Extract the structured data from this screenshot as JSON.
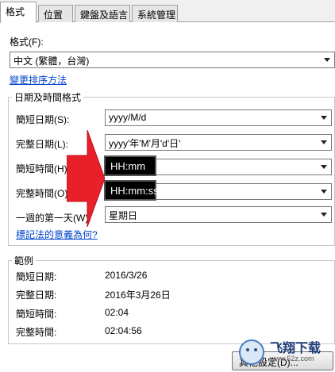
{
  "tabs": [
    {
      "label": "格式"
    },
    {
      "label": "位置"
    },
    {
      "label": "鍵盤及語言"
    },
    {
      "label": "系統管理"
    }
  ],
  "format": {
    "label": "格式(F):",
    "value": "中文 (繁體，台灣)",
    "sort_link": "變更排序方法"
  },
  "datetime": {
    "group_title": "日期及時間格式",
    "short_date_label": "簡短日期(S):",
    "short_date_value": "yyyy/M/d",
    "long_date_label": "完整日期(L):",
    "long_date_value": "yyyy'年'M'月'd'日'",
    "short_time_label": "簡短時間(H):",
    "short_time_value": "HH:mm",
    "long_time_label": "完整時間(O):",
    "long_time_value": "HH:mm:ss",
    "first_day_label": "一週的第一天(W):",
    "first_day_value": "星期日",
    "notation_link": "標記法的意義為何?"
  },
  "examples": {
    "group_title": "範例",
    "rows": [
      {
        "label": "簡短日期:",
        "value": "2016/3/26"
      },
      {
        "label": "完整日期:",
        "value": "2016年3月26日"
      },
      {
        "label": "簡短時間:",
        "value": "02:04"
      },
      {
        "label": "完整時間:",
        "value": "02:04:56"
      }
    ]
  },
  "footer": {
    "other_settings_button": "其他設定(D)..."
  },
  "watermark": {
    "text": "飞翔下载",
    "url": "www.52z.com"
  },
  "colors": {
    "arrow_red": "#e8202a",
    "link_blue": "#0044cc"
  }
}
